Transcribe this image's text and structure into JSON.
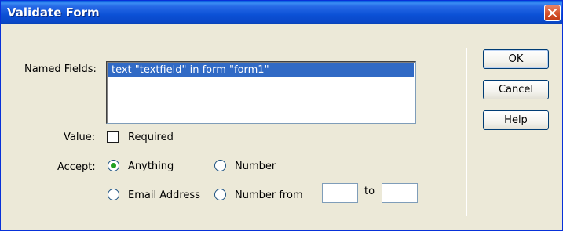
{
  "window": {
    "title": "Validate Form"
  },
  "labels": {
    "named_fields": "Named Fields:",
    "value": "Value:",
    "accept": "Accept:",
    "to": "to"
  },
  "named_fields": {
    "items": [
      "text \"textfield\" in form \"form1\""
    ],
    "selected_index": 0
  },
  "value": {
    "required_label": "Required",
    "required_checked": false
  },
  "accept": {
    "options": {
      "anything": "Anything",
      "number": "Number",
      "email": "Email Address",
      "number_from": "Number from"
    },
    "selected": "anything",
    "from_value": "",
    "to_value": ""
  },
  "buttons": {
    "ok": "OK",
    "cancel": "Cancel",
    "help": "Help"
  },
  "icons": {
    "close": "close-icon"
  },
  "colors": {
    "titlebar": "#0a48c8",
    "selection": "#316ac5",
    "radio_dot": "#21a121"
  }
}
